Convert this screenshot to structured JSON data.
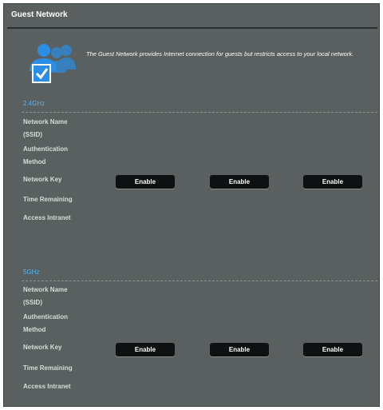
{
  "page": {
    "title": "Guest Network",
    "intro": "The Guest Network provides Internet connection for guests but restricts access to your local network."
  },
  "bands": [
    {
      "title": "2.4GHz",
      "labels": {
        "ssid_1": "Network Name",
        "ssid_2": "(SSID)",
        "auth_1": "Authentication",
        "auth_2": "Method",
        "key": "Network Key",
        "time": "Time Remaining",
        "intranet": "Access Intranet"
      },
      "buttons": [
        "Enable",
        "Enable",
        "Enable"
      ]
    },
    {
      "title": "5GHz",
      "labels": {
        "ssid_1": "Network Name",
        "ssid_2": "(SSID)",
        "auth_1": "Authentication",
        "auth_2": "Method",
        "key": "Network Key",
        "time": "Time Remaining",
        "intranet": "Access Intranet"
      },
      "buttons": [
        "Enable",
        "Enable",
        "Enable"
      ]
    }
  ],
  "icons": {
    "intro": "guest-users-icon"
  },
  "colors": {
    "panel_background": "#59605f",
    "band_title": "#57b3f2",
    "button_background": "#0d1112",
    "icon_blue": "#2a8ee6"
  }
}
